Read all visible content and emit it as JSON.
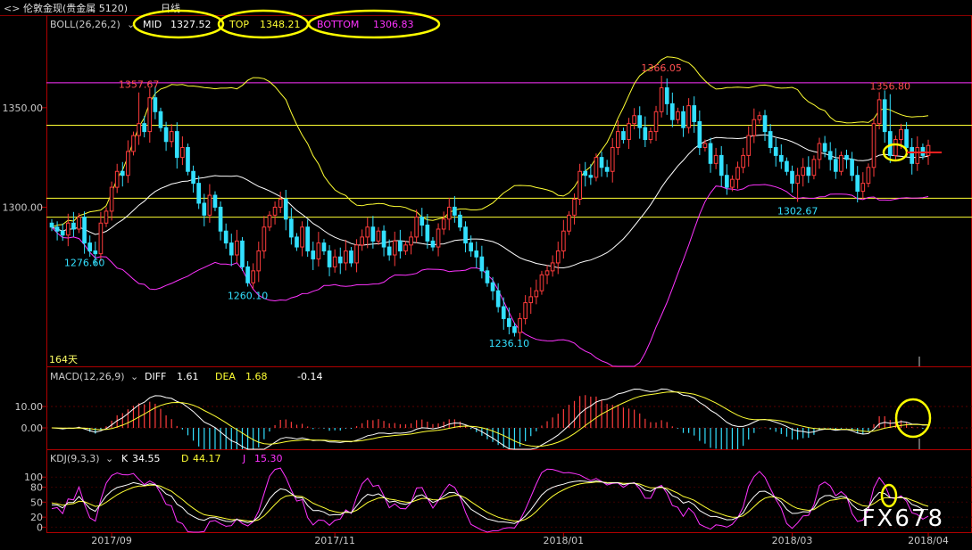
{
  "window": {
    "title": "伦敦金现(贵金属 5120)",
    "period": "日线"
  },
  "colors": {
    "up": "#ff3c3c",
    "down": "#33e0ff",
    "mid": "#ffffff",
    "top": "#ffff33",
    "bottom": "#ff33ff",
    "hline": "#ffff33",
    "hline_top": "#ff33ff",
    "border": "#b00000",
    "axis_text": "#c8c8c8",
    "annot_high": "#ff5050",
    "annot_low": "#33e0ff"
  },
  "boll": {
    "label": "BOLL(26,26,2)",
    "mid_label": "MID",
    "mid_value": "1327.52",
    "top_label": "TOP",
    "top_value": "1348.21",
    "bottom_label": "BOTTOM",
    "bottom_value": "1306.83",
    "bars_label": "164天"
  },
  "macd": {
    "label": "MACD(12,26,9)",
    "diff_label": "DIFF",
    "diff_value": "1.61",
    "dea_label": "DEA",
    "dea_value": "1.68",
    "hist_value": "-0.14"
  },
  "kdj": {
    "label": "KDJ(9,3,3)",
    "k_label": "K",
    "k_value": "34.55",
    "d_label": "D",
    "d_value": "44.17",
    "j_label": "J",
    "j_value": "15.30"
  },
  "watermark": "FX678",
  "chart_data": {
    "type": "candlestick",
    "price_axis": {
      "ticks": [
        {
          "value": 1350,
          "label": "1350.00"
        },
        {
          "value": 1300,
          "label": "1300.00"
        }
      ],
      "ylim": [
        1220,
        1388
      ]
    },
    "macd_axis": {
      "ticks": [
        {
          "value": 10,
          "label": "10.00"
        },
        {
          "value": 0,
          "label": "0.00"
        }
      ],
      "ylim": [
        -10,
        20
      ]
    },
    "kdj_axis": {
      "ticks": [
        {
          "value": 100,
          "label": "100"
        },
        {
          "value": 80,
          "label": "80"
        },
        {
          "value": 50,
          "label": "50"
        },
        {
          "value": 20,
          "label": "20"
        },
        {
          "value": 0,
          "label": "0"
        }
      ],
      "ylim": [
        -10,
        120
      ]
    },
    "x_labels": [
      {
        "index": 11,
        "label": "2017/09"
      },
      {
        "index": 52,
        "label": "2017/11"
      },
      {
        "index": 94,
        "label": "2018/01"
      },
      {
        "index": 136,
        "label": "2018/03"
      },
      {
        "index": 161,
        "label": "2018/04"
      }
    ],
    "horizontal_lines": [
      {
        "value": 1362.5,
        "kind": "top"
      },
      {
        "value": 1341.2,
        "kind": "normal"
      },
      {
        "value": 1304.5,
        "kind": "normal"
      },
      {
        "value": 1295.0,
        "kind": "normal"
      }
    ],
    "annotations": [
      {
        "index": 16,
        "price": 1357.67,
        "label": "1357.67",
        "kind": "high"
      },
      {
        "index": 6,
        "price": 1276.6,
        "label": "1276.60",
        "kind": "low"
      },
      {
        "index": 36,
        "price": 1260.1,
        "label": "1260.10",
        "kind": "low"
      },
      {
        "index": 84,
        "price": 1236.1,
        "label": "1236.10",
        "kind": "low"
      },
      {
        "index": 112,
        "price": 1366.05,
        "label": "1366.05",
        "kind": "high"
      },
      {
        "index": 137,
        "price": 1302.67,
        "label": "1302.67",
        "kind": "low"
      },
      {
        "index": 154,
        "price": 1356.8,
        "label": "1356.80",
        "kind": "high"
      }
    ],
    "closes": [
      1290,
      1288,
      1286,
      1292,
      1289,
      1295,
      1282,
      1278,
      1276.6,
      1292,
      1298,
      1310,
      1318,
      1316,
      1328,
      1336,
      1342,
      1338,
      1355,
      1348,
      1340,
      1333,
      1338,
      1325,
      1330,
      1318,
      1312,
      1302,
      1296,
      1306,
      1300,
      1288,
      1282,
      1276,
      1283,
      1270,
      1262,
      1268,
      1278,
      1290,
      1296,
      1300,
      1304,
      1294,
      1285,
      1280,
      1290,
      1278,
      1274,
      1282,
      1278,
      1270,
      1275,
      1272,
      1278,
      1272,
      1281,
      1285,
      1290,
      1283,
      1288,
      1280,
      1276,
      1283,
      1278,
      1281,
      1285,
      1295,
      1291,
      1283,
      1280,
      1289,
      1294,
      1300,
      1296,
      1290,
      1282,
      1278,
      1275,
      1268,
      1262,
      1258,
      1250,
      1244,
      1240,
      1237,
      1244,
      1252,
      1255,
      1258,
      1266,
      1268,
      1272,
      1278,
      1288,
      1296,
      1304,
      1318,
      1316,
      1315,
      1325,
      1320,
      1318,
      1330,
      1338,
      1334,
      1342,
      1346,
      1340,
      1334,
      1338,
      1348,
      1360,
      1352,
      1344,
      1348,
      1340,
      1351,
      1343,
      1330,
      1332,
      1322,
      1326,
      1316,
      1310,
      1314,
      1320,
      1326,
      1336,
      1344,
      1346,
      1338,
      1330,
      1326,
      1323,
      1318,
      1312,
      1316,
      1320,
      1316,
      1324,
      1332,
      1328,
      1324,
      1318,
      1326,
      1324,
      1316,
      1308,
      1312,
      1320,
      1342,
      1354,
      1338,
      1326,
      1334,
      1339,
      1330,
      1322,
      1330,
      1326,
      1331
    ]
  }
}
